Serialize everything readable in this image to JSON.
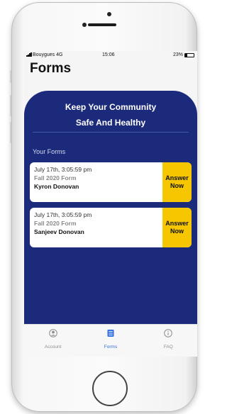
{
  "status_bar": {
    "carrier": "Bouygues 4G",
    "time": "15:06",
    "battery": "23%",
    "battery_level": 0.23
  },
  "header": {
    "title": "Forms"
  },
  "banner": {
    "line1": "Keep Your Community",
    "line2": "Safe And Healthy"
  },
  "section": {
    "label": "Your Forms"
  },
  "forms": [
    {
      "date": "July 17th, 3:05:59 pm",
      "form_name": "Fall 2020 Form",
      "person": "Kyron Donovan",
      "action": {
        "line1": "Answer",
        "line2": "Now"
      }
    },
    {
      "date": "July 17th, 3:05:59 pm",
      "form_name": "Fall 2020 Form",
      "person": "Sanjeev Donovan",
      "action": {
        "line1": "Answer",
        "line2": "Now"
      }
    }
  ],
  "tabbar": {
    "items": [
      {
        "label": "Account",
        "icon": "account-icon",
        "active": false
      },
      {
        "label": "Forms",
        "icon": "list-icon",
        "active": true
      },
      {
        "label": "FAQ",
        "icon": "info-icon",
        "active": false
      }
    ]
  },
  "colors": {
    "panel": "#1b2a7b",
    "accent_button": "#f6c700",
    "active_tab": "#2f6fde",
    "inactive_tab": "#8e8e8e"
  }
}
